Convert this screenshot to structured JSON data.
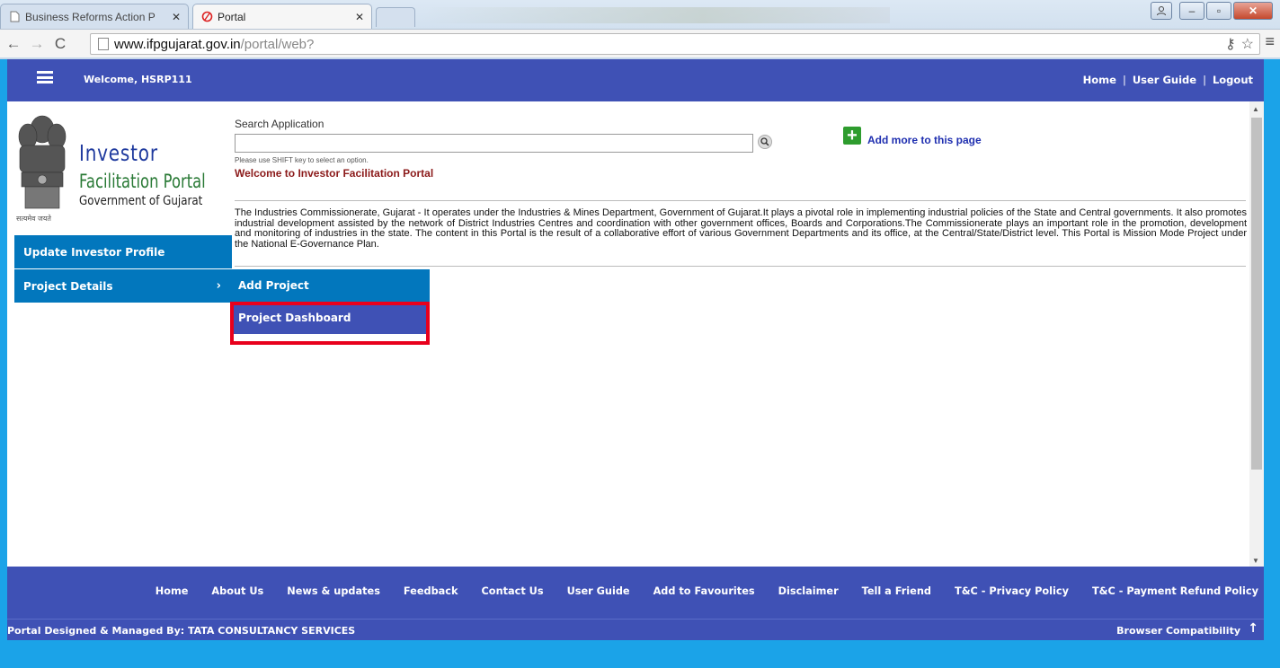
{
  "browser": {
    "tabs": [
      {
        "title": "Business Reforms Action P",
        "active": false
      },
      {
        "title": "Portal",
        "active": true
      }
    ],
    "url_host": "www.ifpgujarat.gov.in",
    "url_path": "/portal/web?"
  },
  "header": {
    "welcome": "Welcome,  HSRP111",
    "links": [
      "Home",
      "User Guide",
      "Logout"
    ]
  },
  "logo": {
    "line1": "Investor",
    "line2": "Facilitation Portal",
    "line3": "Government of Gujarat",
    "motto": "सत्यमेव जयते"
  },
  "search": {
    "label": "Search Application",
    "value": "",
    "hint": "Please use SHIFT key to select an option.",
    "welcome_msg": "Welcome to Investor Facilitation Portal"
  },
  "add_more": "Add more to this page",
  "description": "The Industries Commissionerate, Gujarat - It operates under the Industries & Mines Department, Government of Gujarat.It plays a pivotal role in implementing industrial policies of the State and Central governments. It also promotes industrial development assisted by the network of District Industries Centres and coordination with other government offices, Boards and Corporations.The Commissionerate plays an important role in the promotion, development and monitoring of industries in the state. The content in this Portal is the result of a collaborative effort of various Government Departments and its office, at the Central/State/District level. This Portal is Mission Mode Project under the National E-Governance Plan.",
  "sidebar": {
    "items": [
      {
        "label": "Update Investor Profile"
      },
      {
        "label": "Project Details",
        "chevron": "›"
      }
    ]
  },
  "submenu": {
    "items": [
      {
        "label": "Add Project"
      },
      {
        "label": "Project Dashboard"
      }
    ]
  },
  "footer": {
    "links": [
      "Home",
      "About Us",
      "News & updates",
      "Feedback",
      "Contact Us",
      "User Guide",
      "Add to Favourites",
      "Disclaimer",
      "Tell a Friend",
      "T&C - Privacy Policy",
      "T&C - Payment Refund Policy"
    ],
    "credit": "Portal Designed & Managed By: TATA CONSULTANCY SERVICES",
    "compat": "Browser Compatibility"
  },
  "colors": {
    "header_blue": "#3f51b5",
    "menu_blue": "#0277bd",
    "highlight_red": "#e8001c",
    "welcome_red": "#8b1a1a"
  }
}
